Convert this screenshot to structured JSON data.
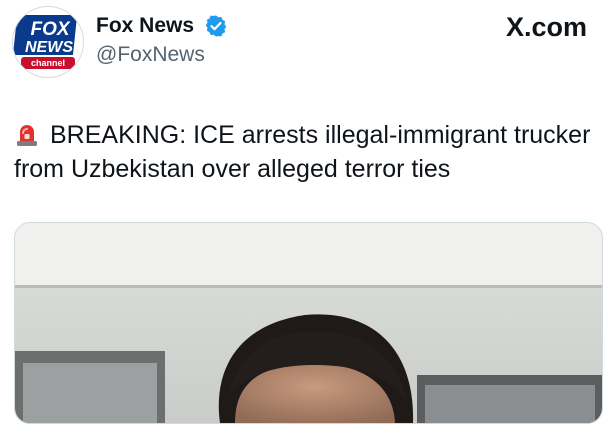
{
  "tweet": {
    "author": {
      "name": "Fox News",
      "handle": "@FoxNews",
      "verified": true,
      "avatar_icon": "fox-news-channel-logo",
      "logo_text": [
        "FOX",
        "NEWS",
        "channel"
      ]
    },
    "watermark": "X.com",
    "text": {
      "emoji": "siren-emoji",
      "body": "BREAKING: ICE arrests illegal-immigrant trucker from Uzbekistan over alleged terror ties"
    },
    "media": {
      "type": "photo"
    }
  },
  "colors": {
    "text": "#0f1419",
    "secondary_text": "#536471",
    "verified_badge": "#1d9bf0",
    "fox_blue": "#0a3a8c",
    "fox_red": "#c8102e",
    "siren_red": "#e0332d"
  }
}
